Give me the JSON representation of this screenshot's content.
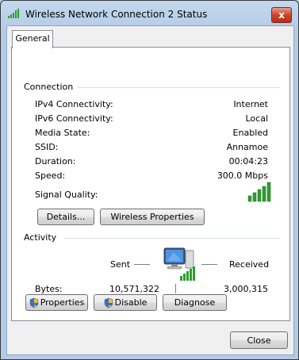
{
  "window": {
    "title": "Wireless Network Connection 2 Status",
    "close_glyph": "x"
  },
  "tabs": [
    {
      "label": "General"
    }
  ],
  "connection": {
    "label": "Connection",
    "rows": [
      {
        "label": "IPv4 Connectivity:",
        "value": "Internet"
      },
      {
        "label": "IPv6 Connectivity:",
        "value": "Local"
      },
      {
        "label": "Media State:",
        "value": "Enabled"
      },
      {
        "label": "SSID:",
        "value": "Annamoe"
      },
      {
        "label": "Duration:",
        "value": "00:04:23"
      },
      {
        "label": "Speed:",
        "value": "300.0 Mbps"
      }
    ],
    "signal_label": "Signal Quality:",
    "signal_bars": 5,
    "details_button": "Details...",
    "wireless_button": "Wireless Properties"
  },
  "activity": {
    "label": "Activity",
    "sent_label": "Sent",
    "received_label": "Received",
    "bytes_label": "Bytes:",
    "bytes_sent": "10,571,322",
    "bytes_received": "3,000,315",
    "icons": [
      "network-computer-icon",
      "wireless-signal-icon"
    ]
  },
  "actions": {
    "properties_button": "Properties",
    "disable_button": "Disable",
    "diagnose_button": "Diagnose"
  },
  "footer": {
    "close_button": "Close"
  },
  "colors": {
    "signal_green": "#2e9e2e",
    "title_bar": "#b9d1ea",
    "close_red": "#c9462c"
  }
}
